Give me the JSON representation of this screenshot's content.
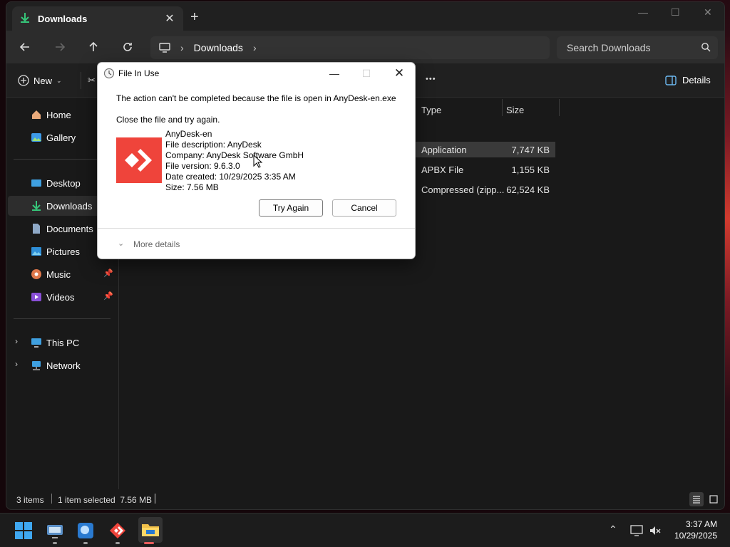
{
  "window": {
    "tab_title": "Downloads",
    "caption_min": "—",
    "caption_max": "☐",
    "caption_close": "✕",
    "new_tab": "+"
  },
  "address": {
    "crumb": "Downloads",
    "search_placeholder": "Search Downloads"
  },
  "toolbar": {
    "new_label": "New",
    "more_label": "•••",
    "details_label": "Details"
  },
  "sidebar": {
    "items": [
      {
        "label": "Home",
        "icon": "home-icon"
      },
      {
        "label": "Gallery",
        "icon": "gallery-icon"
      },
      {
        "label": "Desktop",
        "icon": "desktop-icon"
      },
      {
        "label": "Downloads",
        "icon": "downloads-icon"
      },
      {
        "label": "Documents",
        "icon": "documents-icon"
      },
      {
        "label": "Pictures",
        "icon": "pictures-icon"
      },
      {
        "label": "Music",
        "icon": "music-icon"
      },
      {
        "label": "Videos",
        "icon": "videos-icon"
      },
      {
        "label": "This PC",
        "icon": "this-pc-icon"
      },
      {
        "label": "Network",
        "icon": "network-icon"
      }
    ]
  },
  "files": {
    "columns": [
      "Type",
      "Size"
    ],
    "rows": [
      {
        "type": "Application",
        "size": "7,747 KB",
        "selected": true
      },
      {
        "type": "APBX File",
        "size": "1,155 KB",
        "selected": false
      },
      {
        "type": "Compressed (zipp...",
        "size": "62,524 KB",
        "selected": false
      }
    ]
  },
  "status": {
    "count": "3 items",
    "selection": "1 item selected  7.56 MB"
  },
  "dialog": {
    "title": "File In Use",
    "message": "The action can't be completed because the file is open in AnyDesk-en.exe",
    "instruction": "Close the file and try again.",
    "file_name": "AnyDesk-en",
    "file_description": "File description: AnyDesk",
    "company": "Company: AnyDesk Software GmbH",
    "version": "File version: 9.6.3.0",
    "date_created": "Date created: 10/29/2025 3:35 AM",
    "size": "Size: 7.56 MB",
    "try_again": "Try Again",
    "cancel": "Cancel",
    "more_details": "More details",
    "brand_color": "#ef443b"
  },
  "taskbar": {
    "time": "3:37 AM",
    "date": "10/29/2025"
  }
}
